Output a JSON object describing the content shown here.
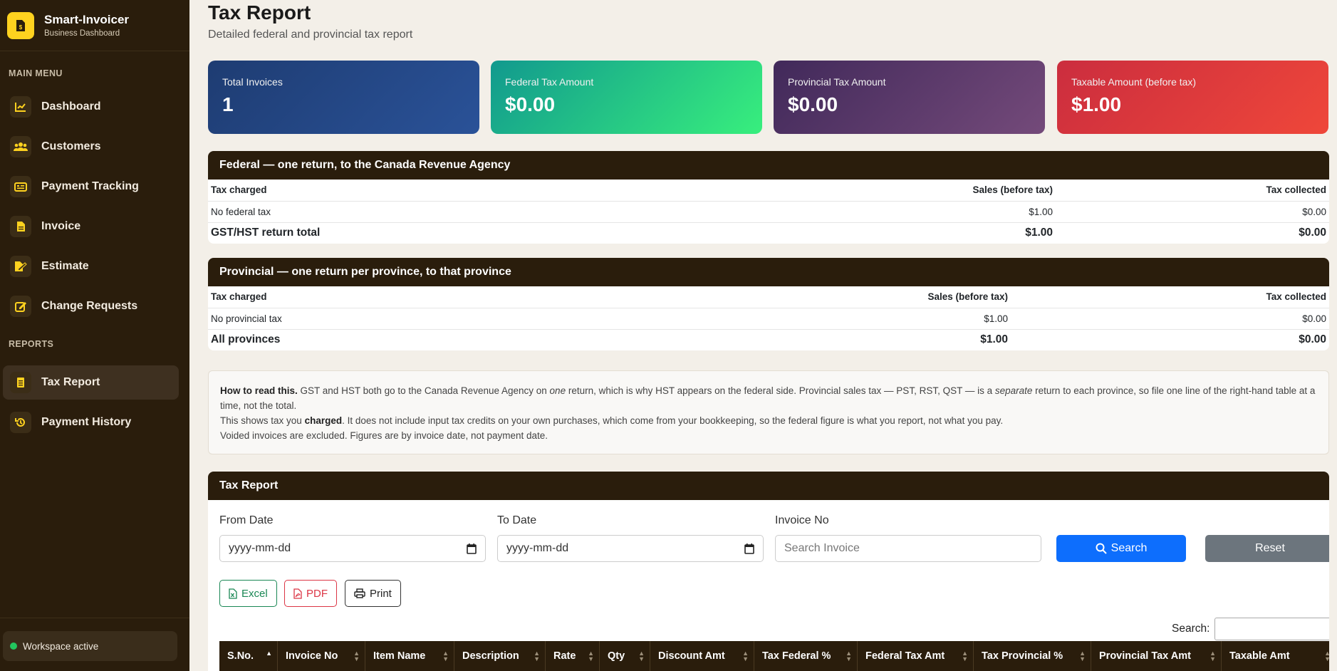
{
  "brand": {
    "title": "Smart-Invoicer",
    "subtitle": "Business Dashboard"
  },
  "sidebar": {
    "main_menu_label": "MAIN MENU",
    "reports_label": "REPORTS",
    "items": [
      {
        "label": "Dashboard",
        "icon": "chart-line-icon"
      },
      {
        "label": "Customers",
        "icon": "users-icon"
      },
      {
        "label": "Payment Tracking",
        "icon": "id-card-icon"
      },
      {
        "label": "Invoice",
        "icon": "file-icon"
      },
      {
        "label": "Estimate",
        "icon": "file-signature-icon"
      },
      {
        "label": "Change Requests",
        "icon": "edit-icon"
      }
    ],
    "report_items": [
      {
        "label": "Tax Report",
        "icon": "document-icon",
        "active": true
      },
      {
        "label": "Payment History",
        "icon": "history-icon"
      }
    ],
    "workspace_status": "Workspace active"
  },
  "page": {
    "title": "Tax Report",
    "subtitle": "Detailed federal and provincial tax report"
  },
  "summary_cards": [
    {
      "label": "Total Invoices",
      "value": "1",
      "gradient": [
        "#1e3c72",
        "#2a5298"
      ]
    },
    {
      "label": "Federal Tax Amount",
      "value": "$0.00",
      "gradient": [
        "#11998e",
        "#38ef7d"
      ]
    },
    {
      "label": "Provincial Tax Amount",
      "value": "$0.00",
      "gradient": [
        "#41295a",
        "#744a7a"
      ]
    },
    {
      "label": "Taxable Amount (before tax)",
      "value": "$1.00",
      "gradient": [
        "#cb2d3e",
        "#ef473a"
      ]
    }
  ],
  "federal": {
    "heading": "Federal — one return, to the Canada Revenue Agency",
    "columns": [
      "Tax charged",
      "Sales (before tax)",
      "Tax collected"
    ],
    "row": [
      "No federal tax",
      "$1.00",
      "$0.00"
    ],
    "total": [
      "GST/HST return total",
      "$1.00",
      "$0.00"
    ]
  },
  "provincial": {
    "heading": "Provincial — one return per province, to that province",
    "columns": [
      "Tax charged",
      "Sales (before tax)",
      "Tax collected"
    ],
    "row": [
      "No provincial tax",
      "$1.00",
      "$0.00"
    ],
    "total": [
      "All provinces",
      "$1.00",
      "$0.00"
    ]
  },
  "note": {
    "title": "How to read this.",
    "p1a": "GST and HST both go to the Canada Revenue Agency on",
    "p1b": "one",
    "p1c": "return, which is why HST appears on the federal side. Provincial sales tax — PST, RST, QST — is a",
    "p1d": "separate",
    "p1e": "return to each province, so file one line of the right-hand table at a time, not the total.",
    "p2a": "This shows tax you",
    "p2b": "charged",
    "p2c": ". It does not include input tax credits on your own purchases, which come from your bookkeeping, so the federal figure is what you report, not what you pay.",
    "p3": "Voided invoices are excluded. Figures are by invoice date, not payment date."
  },
  "report": {
    "heading": "Tax Report",
    "from_label": "From Date",
    "from_value": "yyyy-mm-dd",
    "to_label": "To Date",
    "to_value": "yyyy-mm-dd",
    "invoice_label": "Invoice No",
    "invoice_placeholder": "Search Invoice",
    "search_button": "Search",
    "reset_button": "Reset",
    "excel": "Excel",
    "pdf": "PDF",
    "print": "Print",
    "dt_search_label": "Search:",
    "columns": [
      "S.No.",
      "Invoice No",
      "Item Name",
      "Description",
      "Rate",
      "Qty",
      "Discount Amt",
      "Tax Federal %",
      "Federal Tax Amt",
      "Tax Provincial %",
      "Provincial Tax Amt",
      "Taxable Amt"
    ]
  }
}
